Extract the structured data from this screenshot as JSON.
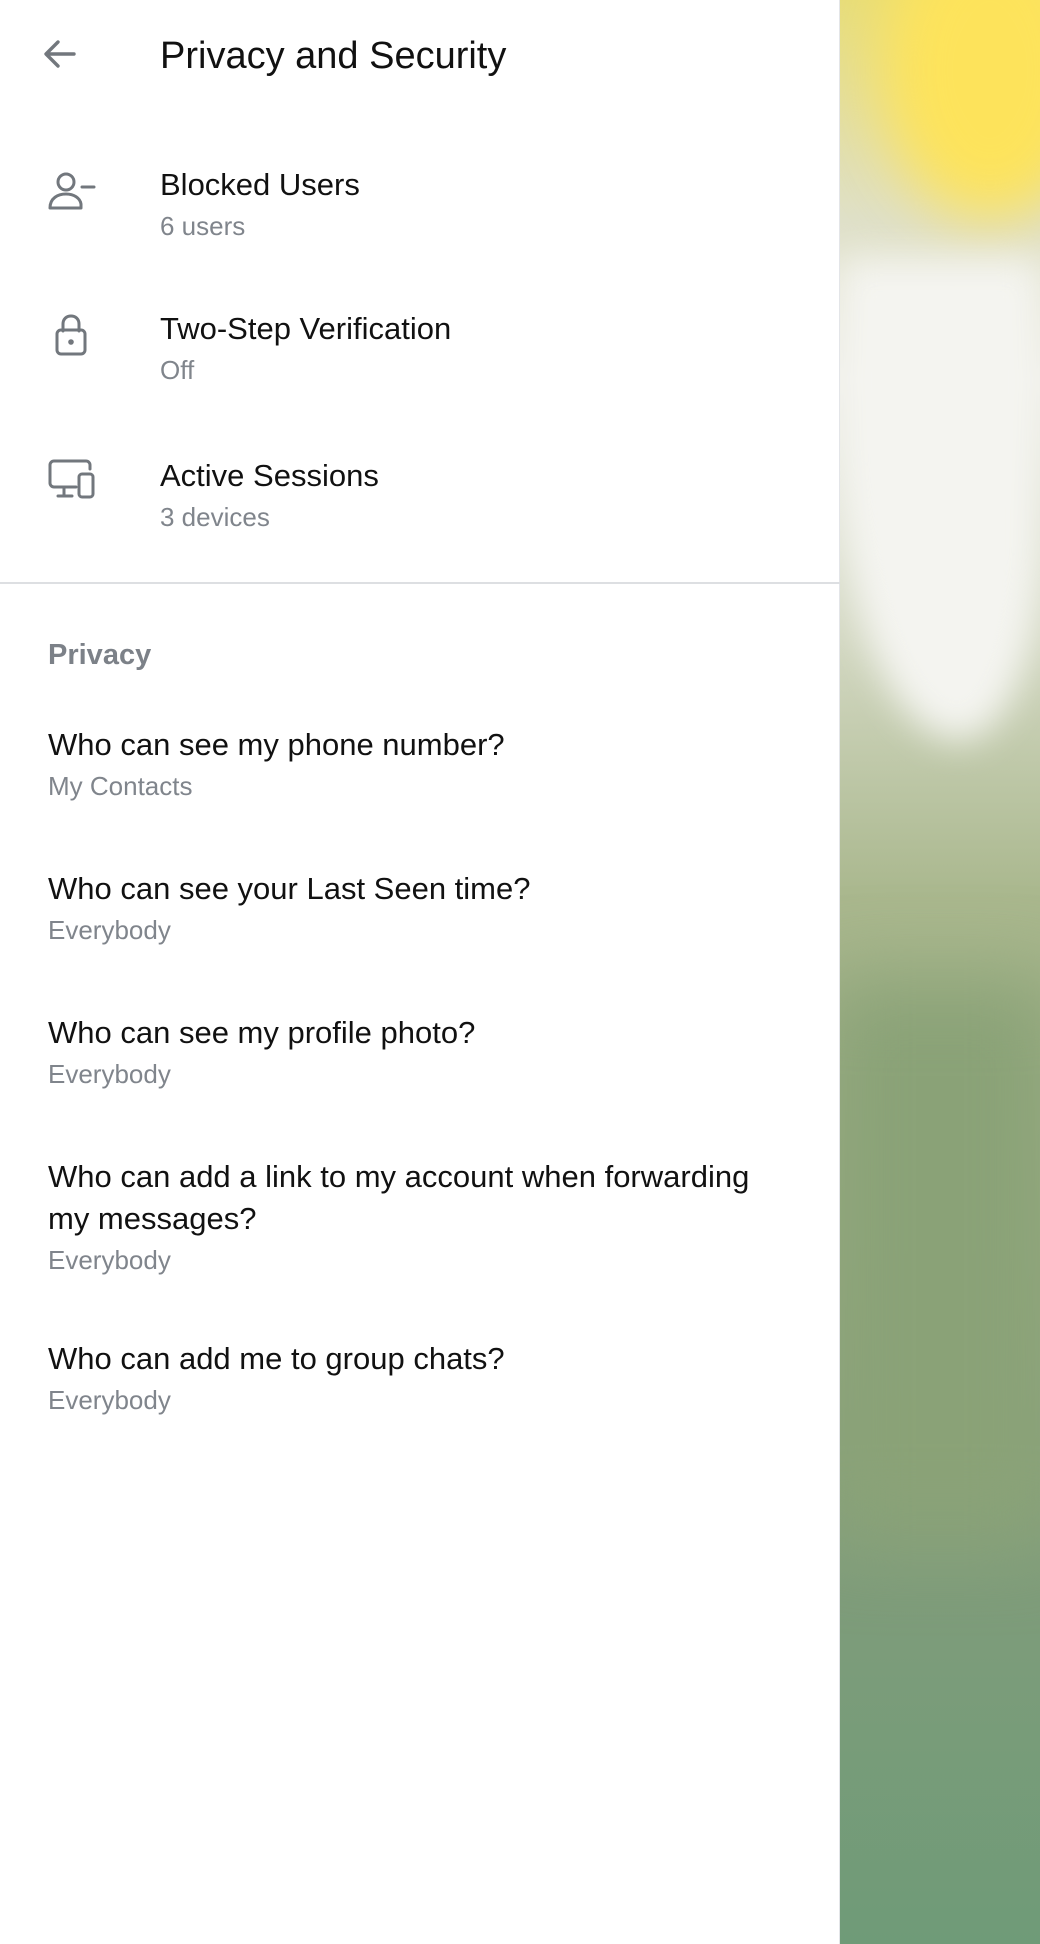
{
  "header": {
    "title": "Privacy and Security",
    "back_icon": "arrow-left-icon"
  },
  "security_items": [
    {
      "label": "Blocked Users",
      "value": "6 users",
      "icon": "user-minus-icon"
    },
    {
      "label": "Two-Step Verification",
      "value": "Off",
      "icon": "lock-icon"
    },
    {
      "label": "Active Sessions",
      "value": "3 devices",
      "icon": "devices-icon"
    }
  ],
  "privacy": {
    "header": "Privacy",
    "items": [
      {
        "label": "Who can see my phone number?",
        "value": "My Contacts"
      },
      {
        "label": "Who can see your Last Seen time?",
        "value": "Everybody"
      },
      {
        "label": "Who can see my profile photo?",
        "value": "Everybody"
      },
      {
        "label": "Who can add a link to my account when forwarding my messages?",
        "value": "Everybody"
      },
      {
        "label": "Who can add me to group chats?",
        "value": "Everybody"
      }
    ]
  },
  "colors": {
    "text_primary": "#111111",
    "text_secondary": "#80858c",
    "icon": "#72777d",
    "divider": "#dddfe2"
  }
}
